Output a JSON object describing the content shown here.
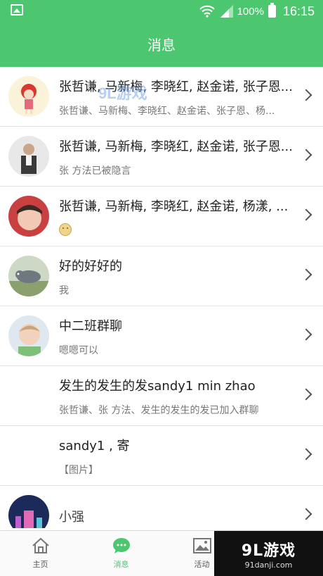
{
  "status_bar": {
    "battery": "100%",
    "time": "16:15"
  },
  "header": {
    "title": "消息"
  },
  "conversations": [
    {
      "name": "张哲谦, 马新梅, 李晓红, 赵金诺, 张子恩...",
      "preview": "张哲谦、马新梅、李晓红、赵金诺、张子恩、杨..."
    },
    {
      "name": "张哲谦, 马新梅, 李晓红, 赵金诺, 张子恩...",
      "preview": "张 方法已被隐言"
    },
    {
      "name": "张哲谦, 马新梅, 李晓红, 赵金诺, 杨漾, ...",
      "preview": ""
    },
    {
      "name": "好的好好的",
      "preview": "我"
    },
    {
      "name": "中二班群聊",
      "preview": "嗯嗯可以"
    },
    {
      "name": "发生的发生的发sandy1 min zhao",
      "preview": "张哲谦、张 方法、发生的发生的发已加入群聊"
    },
    {
      "name": "sandy1 , 寄",
      "preview": "【图片】"
    },
    {
      "name": "小强",
      "preview": ""
    }
  ],
  "tabs": [
    {
      "label": "主页",
      "icon": "home-icon"
    },
    {
      "label": "消息",
      "icon": "chat-icon"
    },
    {
      "label": "活动",
      "icon": "image-icon"
    }
  ],
  "watermark": {
    "logo_text": "9L游戏",
    "site": "91danji.com",
    "overlay_text": "9L游戏"
  },
  "colors": {
    "accent": "#4cc66f"
  }
}
